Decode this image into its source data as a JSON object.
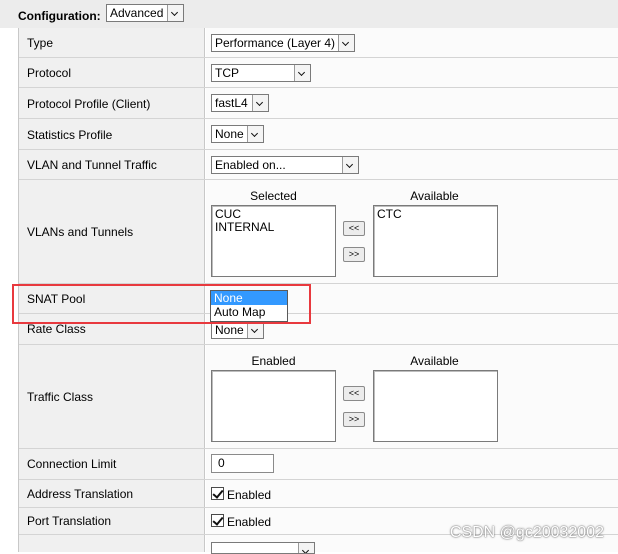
{
  "configuration": {
    "label": "Configuration:",
    "value": "Advanced"
  },
  "rows": {
    "type": {
      "label": "Type",
      "value": "Performance (Layer 4)"
    },
    "protocol": {
      "label": "Protocol",
      "value": "TCP"
    },
    "protocol_profile": {
      "label": "Protocol Profile (Client)",
      "value": "fastL4"
    },
    "statistics_profile": {
      "label": "Statistics Profile",
      "value": "None"
    },
    "vlan_traffic": {
      "label": "VLAN and Tunnel Traffic",
      "value": "Enabled on..."
    },
    "vlans": {
      "label": "VLANs and Tunnels",
      "selected_header": "Selected",
      "available_header": "Available",
      "selected_items": [
        "CUC",
        "INTERNAL"
      ],
      "available_items": [
        "CTC"
      ],
      "move_left": "<<",
      "move_right": ">>"
    },
    "snat_pool": {
      "label": "SNAT Pool",
      "options": [
        "None",
        "Auto Map"
      ],
      "selected": "None"
    },
    "rate_class": {
      "label": "Rate Class",
      "value": "None"
    },
    "traffic_class": {
      "label": "Traffic Class",
      "enabled_header": "Enabled",
      "available_header": "Available",
      "move_left": "<<",
      "move_right": ">>"
    },
    "connection_limit": {
      "label": "Connection Limit",
      "value": "0"
    },
    "address_translation": {
      "label": "Address Translation",
      "checkbox_label": "Enabled",
      "checked": true
    },
    "port_translation": {
      "label": "Port Translation",
      "checkbox_label": "Enabled",
      "checked": true
    }
  },
  "watermark": "CSDN @gc20032002",
  "colors": {
    "highlight": "#e8393e",
    "option_selected": "#3399ff"
  }
}
